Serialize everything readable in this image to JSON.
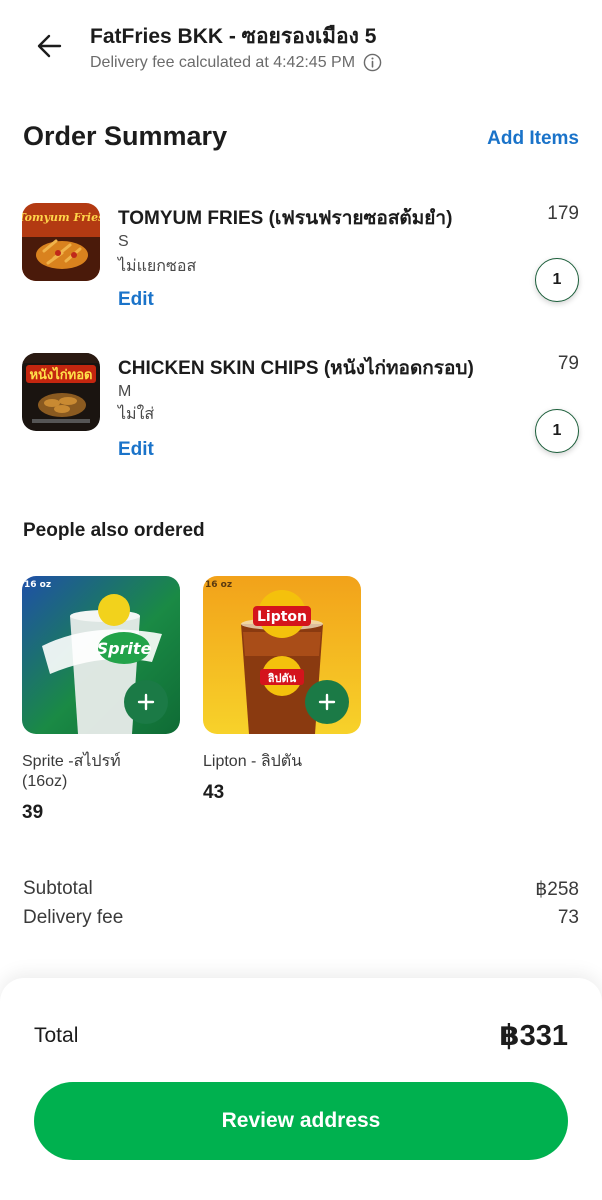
{
  "header": {
    "store_name": "FatFries BKK - ซอยรองเมือง 5",
    "fee_note": "Delivery fee calculated at 4:42:45 PM",
    "back_icon": "arrow-left-icon",
    "info_icon": "info-icon"
  },
  "summary": {
    "title": "Order Summary",
    "add_items": "Add Items"
  },
  "items": [
    {
      "name": "TOMYUM FRIES (เฟรนฟรายซอสต้มยำ)",
      "price": "179",
      "size": "S",
      "option": "ไม่แยกซอส",
      "edit": "Edit",
      "qty": "1",
      "image_text": "Tomyum Fries"
    },
    {
      "name": "CHICKEN SKIN CHIPS (หนังไก่ทอดกรอบ)",
      "price": "79",
      "size": "M",
      "option": "ไม่ใส่",
      "edit": "Edit",
      "qty": "1",
      "image_text": "หนังไก่ทอด"
    }
  ],
  "also_ordered": {
    "title": "People also ordered",
    "items": [
      {
        "name": "Sprite -สไปรท์\n(16oz)",
        "price": "39",
        "badge": "16 oz",
        "logo": "Sprite"
      },
      {
        "name": "Lipton - ลิปตัน",
        "price": "43",
        "badge": "16 oz",
        "logo": "Lipton",
        "logo_th": "ลิปตัน"
      }
    ]
  },
  "totals": {
    "subtotal_label": "Subtotal",
    "subtotal_value": "฿258",
    "delivery_label": "Delivery fee",
    "delivery_value": "73",
    "total_label": "Total",
    "total_value": "฿331"
  },
  "cta": {
    "label": "Review address"
  },
  "colors": {
    "primary_green": "#00b14f",
    "link_blue": "#1a73c9",
    "add_button_green": "#1b7a46"
  }
}
